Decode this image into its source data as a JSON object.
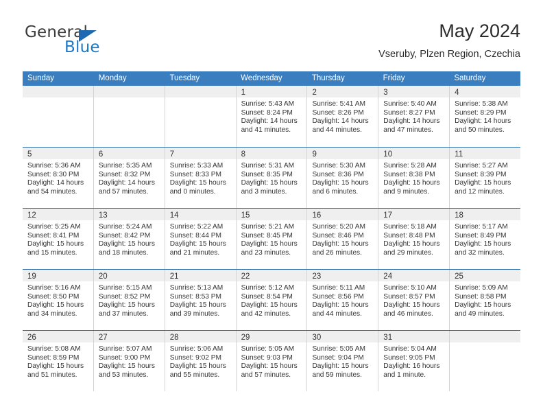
{
  "brand": {
    "name_top": "General",
    "name_bottom": "Blue",
    "accent_color": "#1b79c9",
    "triangle_color": "#1f69b0"
  },
  "header": {
    "title": "May 2024",
    "subtitle": "Vseruby, Plzen Region, Czechia"
  },
  "calendar": {
    "header_color": "#3a7ec0",
    "weekdays": [
      "Sunday",
      "Monday",
      "Tuesday",
      "Wednesday",
      "Thursday",
      "Friday",
      "Saturday"
    ],
    "labels": {
      "sunrise": "Sunrise:",
      "sunset": "Sunset:",
      "daylight": "Daylight:"
    },
    "weeks": [
      [
        {
          "day": "",
          "empty": true
        },
        {
          "day": "",
          "empty": true
        },
        {
          "day": "",
          "empty": true
        },
        {
          "day": "1",
          "sunrise": "Sunrise: 5:43 AM",
          "sunset": "Sunset: 8:24 PM",
          "daylight1": "Daylight: 14 hours",
          "daylight2": "and 41 minutes."
        },
        {
          "day": "2",
          "sunrise": "Sunrise: 5:41 AM",
          "sunset": "Sunset: 8:26 PM",
          "daylight1": "Daylight: 14 hours",
          "daylight2": "and 44 minutes."
        },
        {
          "day": "3",
          "sunrise": "Sunrise: 5:40 AM",
          "sunset": "Sunset: 8:27 PM",
          "daylight1": "Daylight: 14 hours",
          "daylight2": "and 47 minutes."
        },
        {
          "day": "4",
          "sunrise": "Sunrise: 5:38 AM",
          "sunset": "Sunset: 8:29 PM",
          "daylight1": "Daylight: 14 hours",
          "daylight2": "and 50 minutes."
        }
      ],
      [
        {
          "day": "5",
          "sunrise": "Sunrise: 5:36 AM",
          "sunset": "Sunset: 8:30 PM",
          "daylight1": "Daylight: 14 hours",
          "daylight2": "and 54 minutes."
        },
        {
          "day": "6",
          "sunrise": "Sunrise: 5:35 AM",
          "sunset": "Sunset: 8:32 PM",
          "daylight1": "Daylight: 14 hours",
          "daylight2": "and 57 minutes."
        },
        {
          "day": "7",
          "sunrise": "Sunrise: 5:33 AM",
          "sunset": "Sunset: 8:33 PM",
          "daylight1": "Daylight: 15 hours",
          "daylight2": "and 0 minutes."
        },
        {
          "day": "8",
          "sunrise": "Sunrise: 5:31 AM",
          "sunset": "Sunset: 8:35 PM",
          "daylight1": "Daylight: 15 hours",
          "daylight2": "and 3 minutes."
        },
        {
          "day": "9",
          "sunrise": "Sunrise: 5:30 AM",
          "sunset": "Sunset: 8:36 PM",
          "daylight1": "Daylight: 15 hours",
          "daylight2": "and 6 minutes."
        },
        {
          "day": "10",
          "sunrise": "Sunrise: 5:28 AM",
          "sunset": "Sunset: 8:38 PM",
          "daylight1": "Daylight: 15 hours",
          "daylight2": "and 9 minutes."
        },
        {
          "day": "11",
          "sunrise": "Sunrise: 5:27 AM",
          "sunset": "Sunset: 8:39 PM",
          "daylight1": "Daylight: 15 hours",
          "daylight2": "and 12 minutes."
        }
      ],
      [
        {
          "day": "12",
          "sunrise": "Sunrise: 5:25 AM",
          "sunset": "Sunset: 8:41 PM",
          "daylight1": "Daylight: 15 hours",
          "daylight2": "and 15 minutes."
        },
        {
          "day": "13",
          "sunrise": "Sunrise: 5:24 AM",
          "sunset": "Sunset: 8:42 PM",
          "daylight1": "Daylight: 15 hours",
          "daylight2": "and 18 minutes."
        },
        {
          "day": "14",
          "sunrise": "Sunrise: 5:22 AM",
          "sunset": "Sunset: 8:44 PM",
          "daylight1": "Daylight: 15 hours",
          "daylight2": "and 21 minutes."
        },
        {
          "day": "15",
          "sunrise": "Sunrise: 5:21 AM",
          "sunset": "Sunset: 8:45 PM",
          "daylight1": "Daylight: 15 hours",
          "daylight2": "and 23 minutes."
        },
        {
          "day": "16",
          "sunrise": "Sunrise: 5:20 AM",
          "sunset": "Sunset: 8:46 PM",
          "daylight1": "Daylight: 15 hours",
          "daylight2": "and 26 minutes."
        },
        {
          "day": "17",
          "sunrise": "Sunrise: 5:18 AM",
          "sunset": "Sunset: 8:48 PM",
          "daylight1": "Daylight: 15 hours",
          "daylight2": "and 29 minutes."
        },
        {
          "day": "18",
          "sunrise": "Sunrise: 5:17 AM",
          "sunset": "Sunset: 8:49 PM",
          "daylight1": "Daylight: 15 hours",
          "daylight2": "and 32 minutes."
        }
      ],
      [
        {
          "day": "19",
          "sunrise": "Sunrise: 5:16 AM",
          "sunset": "Sunset: 8:50 PM",
          "daylight1": "Daylight: 15 hours",
          "daylight2": "and 34 minutes."
        },
        {
          "day": "20",
          "sunrise": "Sunrise: 5:15 AM",
          "sunset": "Sunset: 8:52 PM",
          "daylight1": "Daylight: 15 hours",
          "daylight2": "and 37 minutes."
        },
        {
          "day": "21",
          "sunrise": "Sunrise: 5:13 AM",
          "sunset": "Sunset: 8:53 PM",
          "daylight1": "Daylight: 15 hours",
          "daylight2": "and 39 minutes."
        },
        {
          "day": "22",
          "sunrise": "Sunrise: 5:12 AM",
          "sunset": "Sunset: 8:54 PM",
          "daylight1": "Daylight: 15 hours",
          "daylight2": "and 42 minutes."
        },
        {
          "day": "23",
          "sunrise": "Sunrise: 5:11 AM",
          "sunset": "Sunset: 8:56 PM",
          "daylight1": "Daylight: 15 hours",
          "daylight2": "and 44 minutes."
        },
        {
          "day": "24",
          "sunrise": "Sunrise: 5:10 AM",
          "sunset": "Sunset: 8:57 PM",
          "daylight1": "Daylight: 15 hours",
          "daylight2": "and 46 minutes."
        },
        {
          "day": "25",
          "sunrise": "Sunrise: 5:09 AM",
          "sunset": "Sunset: 8:58 PM",
          "daylight1": "Daylight: 15 hours",
          "daylight2": "and 49 minutes."
        }
      ],
      [
        {
          "day": "26",
          "sunrise": "Sunrise: 5:08 AM",
          "sunset": "Sunset: 8:59 PM",
          "daylight1": "Daylight: 15 hours",
          "daylight2": "and 51 minutes."
        },
        {
          "day": "27",
          "sunrise": "Sunrise: 5:07 AM",
          "sunset": "Sunset: 9:00 PM",
          "daylight1": "Daylight: 15 hours",
          "daylight2": "and 53 minutes."
        },
        {
          "day": "28",
          "sunrise": "Sunrise: 5:06 AM",
          "sunset": "Sunset: 9:02 PM",
          "daylight1": "Daylight: 15 hours",
          "daylight2": "and 55 minutes."
        },
        {
          "day": "29",
          "sunrise": "Sunrise: 5:05 AM",
          "sunset": "Sunset: 9:03 PM",
          "daylight1": "Daylight: 15 hours",
          "daylight2": "and 57 minutes."
        },
        {
          "day": "30",
          "sunrise": "Sunrise: 5:05 AM",
          "sunset": "Sunset: 9:04 PM",
          "daylight1": "Daylight: 15 hours",
          "daylight2": "and 59 minutes."
        },
        {
          "day": "31",
          "sunrise": "Sunrise: 5:04 AM",
          "sunset": "Sunset: 9:05 PM",
          "daylight1": "Daylight: 16 hours",
          "daylight2": "and 1 minute."
        },
        {
          "day": "",
          "empty": true
        }
      ]
    ]
  }
}
